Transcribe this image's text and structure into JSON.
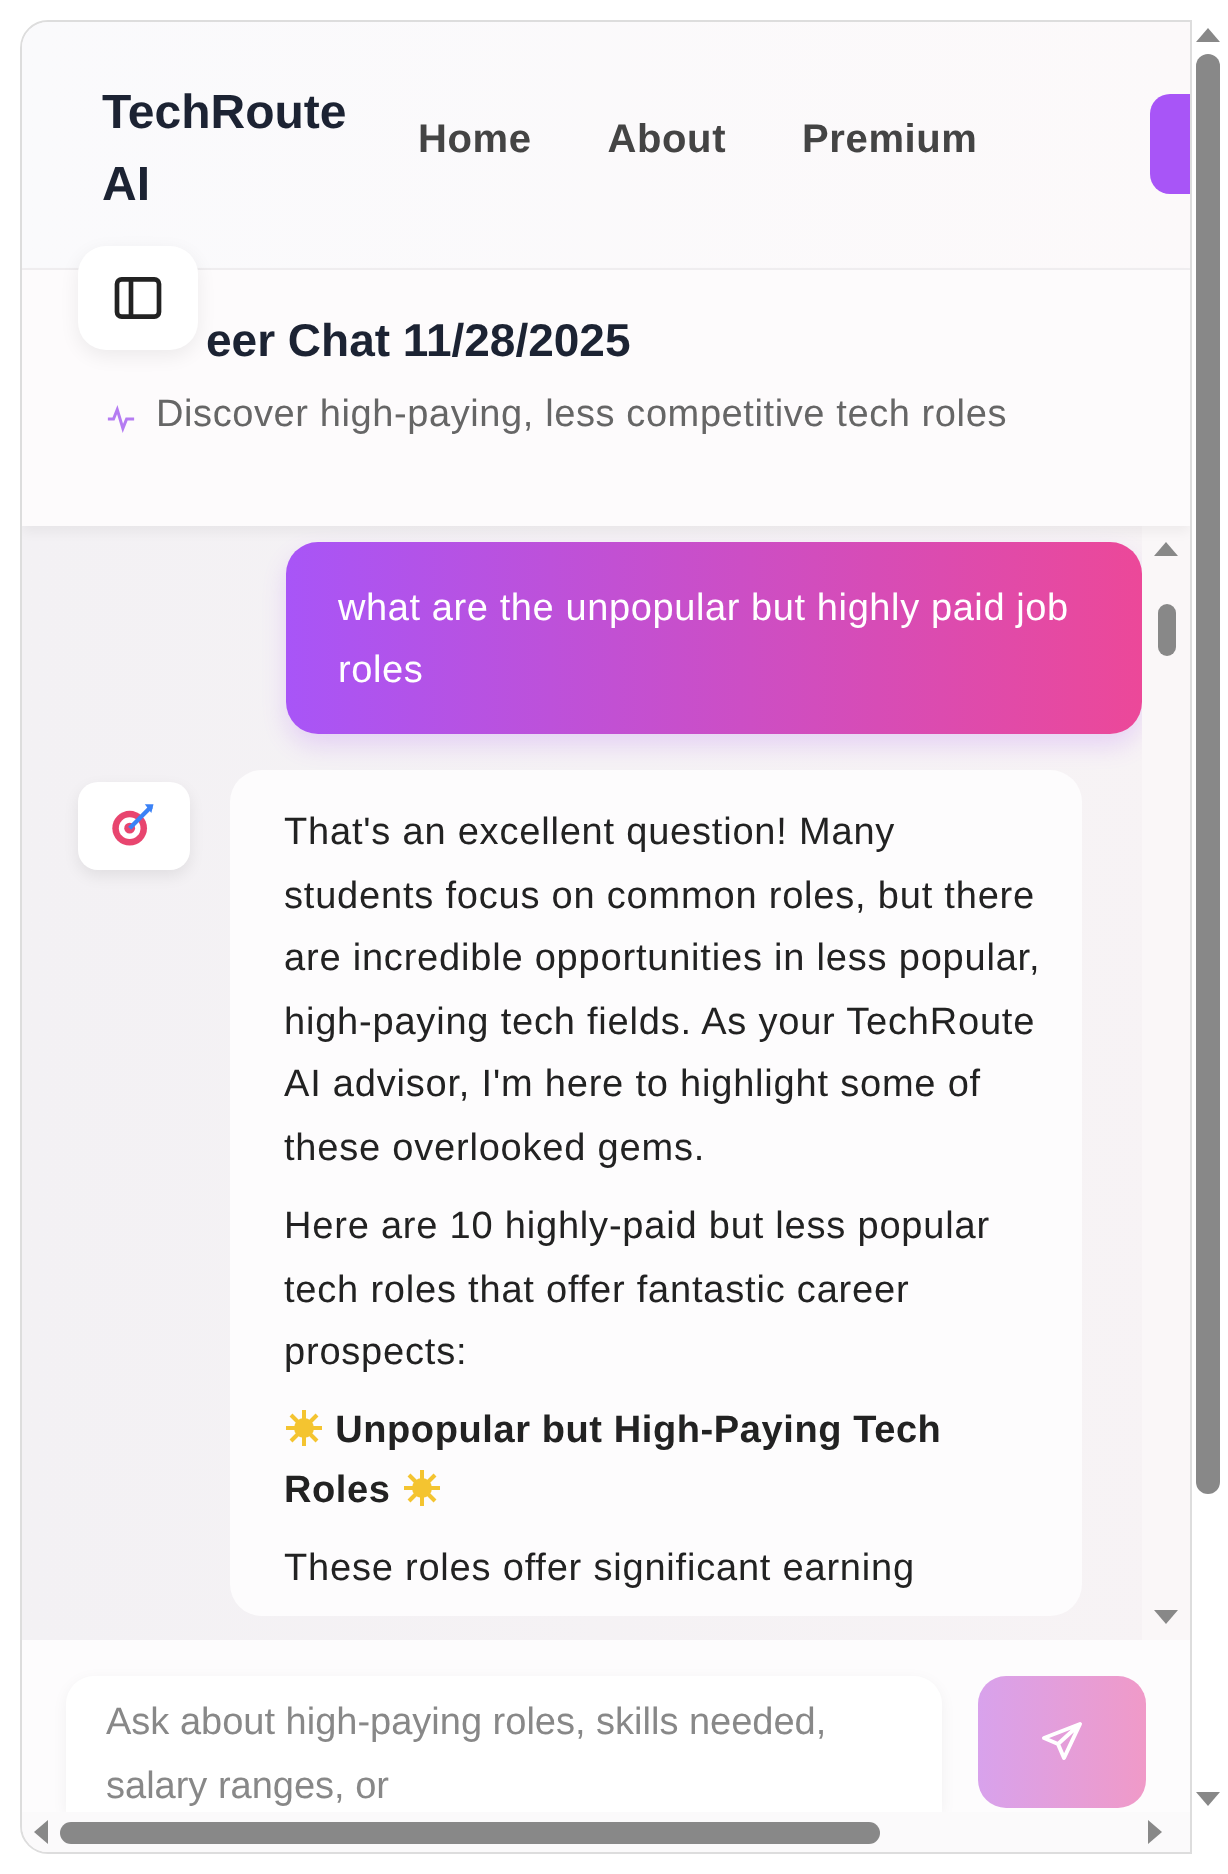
{
  "header": {
    "logo": "TechRoute AI",
    "nav": [
      {
        "label": "Home"
      },
      {
        "label": "About"
      },
      {
        "label": "Premium"
      }
    ]
  },
  "chat": {
    "title": "eer Chat 11/28/2025",
    "subtitle": "Discover high-paying, less competitive tech roles"
  },
  "messages": [
    {
      "kind": "user",
      "blocks": [
        {
          "kind": "paragraph",
          "text": "what are the unpopular but highly paid job roles"
        }
      ]
    },
    {
      "kind": "assistant",
      "blocks": [
        {
          "kind": "paragraph",
          "text": "That's an excellent question! Many students focus on common roles, but there are incredible opportunities in less popular, high-paying tech fields. As your TechRoute AI advisor, I'm here to highlight some of these overlooked gems."
        },
        {
          "kind": "paragraph",
          "text": "Here are 10 highly-paid but less popular tech roles that offer fantastic career prospects:"
        },
        {
          "kind": "heading",
          "text": "Unpopular but High-Paying Tech Roles"
        },
        {
          "kind": "paragraph",
          "text": "These roles offer significant earning"
        }
      ]
    }
  ],
  "composer": {
    "placeholder": "Ask about high-paying roles, skills needed, salary ranges, or"
  }
}
